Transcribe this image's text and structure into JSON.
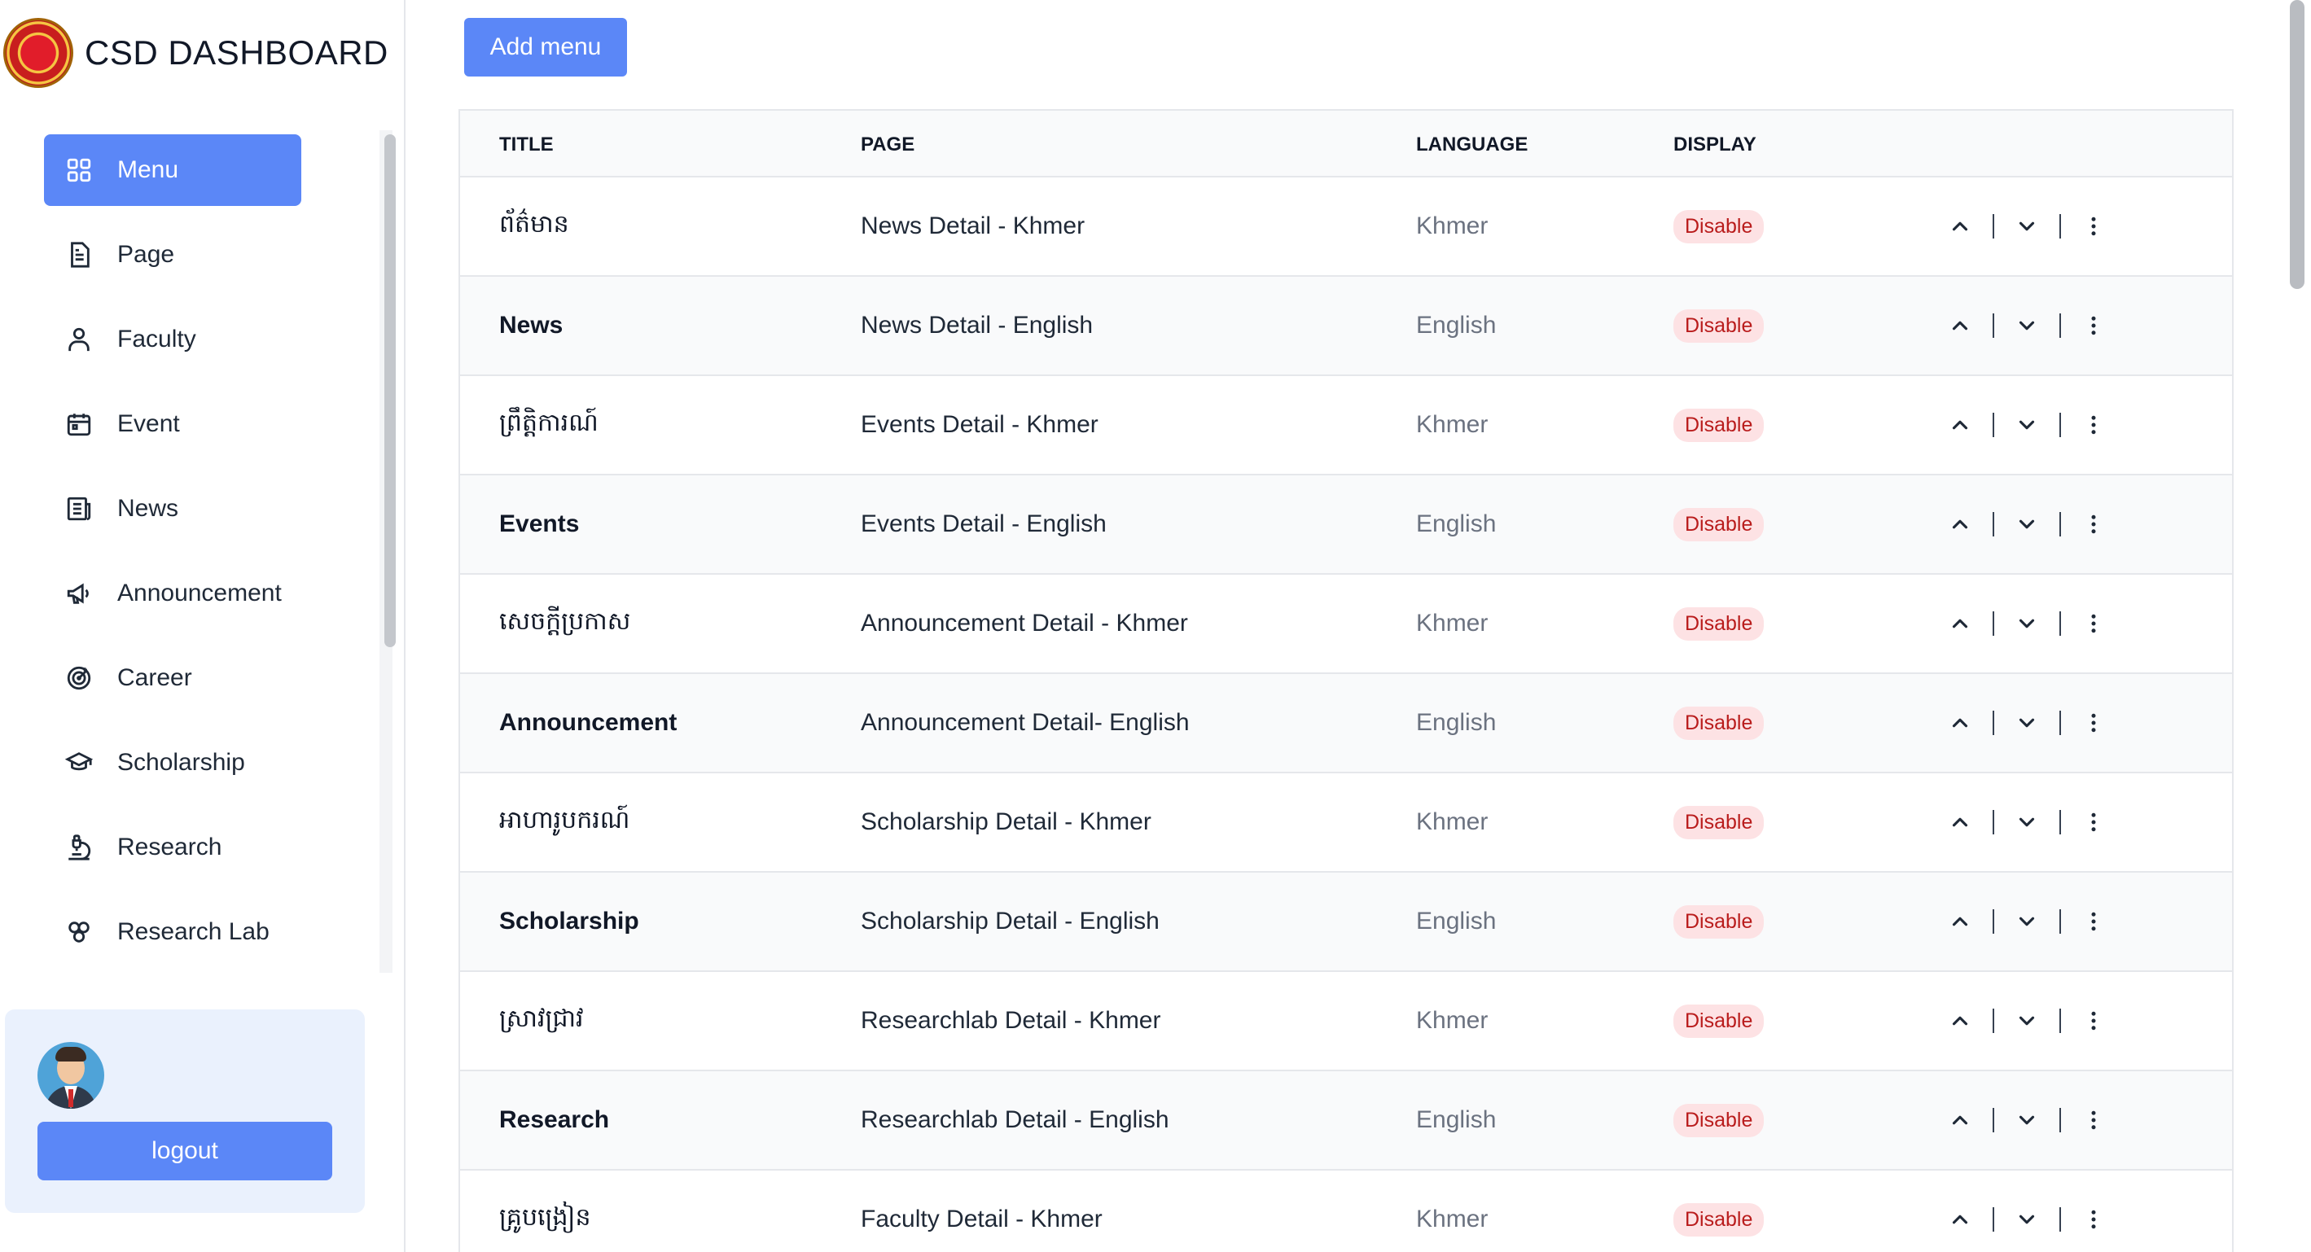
{
  "app": {
    "title": "CSD DASHBOARD"
  },
  "sidebar": {
    "items": [
      {
        "label": "Menu",
        "icon": "grid-icon",
        "active": true
      },
      {
        "label": "Page",
        "icon": "document-icon"
      },
      {
        "label": "Faculty",
        "icon": "user-icon"
      },
      {
        "label": "Event",
        "icon": "calendar-icon"
      },
      {
        "label": "News",
        "icon": "newspaper-icon"
      },
      {
        "label": "Announcement",
        "icon": "megaphone-icon"
      },
      {
        "label": "Career",
        "icon": "target-icon"
      },
      {
        "label": "Scholarship",
        "icon": "graduation-cap-icon"
      },
      {
        "label": "Research",
        "icon": "microscope-icon"
      },
      {
        "label": "Research Lab",
        "icon": "molecule-icon"
      }
    ]
  },
  "user": {
    "logout_label": "logout"
  },
  "toolbar": {
    "add_label": "Add menu"
  },
  "table": {
    "headers": {
      "title": "TITLE",
      "page": "PAGE",
      "language": "LANGUAGE",
      "display": "DISPLAY"
    },
    "rows": [
      {
        "title": "ព័ត៌មាន",
        "page": "News Detail - Khmer",
        "language": "Khmer",
        "display": "Disable"
      },
      {
        "title": "News",
        "page": "News Detail - English",
        "language": "English",
        "display": "Disable"
      },
      {
        "title": "ព្រឹត្តិការណ៍",
        "page": "Events Detail - Khmer",
        "language": "Khmer",
        "display": "Disable"
      },
      {
        "title": "Events",
        "page": "Events Detail - English",
        "language": "English",
        "display": "Disable"
      },
      {
        "title": "សេចក្តីប្រកាស",
        "page": "Announcement Detail - Khmer",
        "language": "Khmer",
        "display": "Disable"
      },
      {
        "title": "Announcement",
        "page": "Announcement Detail- English",
        "language": "English",
        "display": "Disable"
      },
      {
        "title": "អាហារូបករណ៍",
        "page": "Scholarship Detail - Khmer",
        "language": "Khmer",
        "display": "Disable"
      },
      {
        "title": "Scholarship",
        "page": "Scholarship Detail - English",
        "language": "English",
        "display": "Disable"
      },
      {
        "title": "ស្រាវជ្រាវ",
        "page": "Researchlab Detail - Khmer",
        "language": "Khmer",
        "display": "Disable"
      },
      {
        "title": "Research",
        "page": "Researchlab Detail - English",
        "language": "English",
        "display": "Disable"
      },
      {
        "title": "គ្រូបង្រៀន",
        "page": "Faculty Detail - Khmer",
        "language": "Khmer",
        "display": "Disable"
      }
    ]
  },
  "colors": {
    "accent": "#5b87f7",
    "badge_bg": "#fde2e4",
    "badge_text": "#b91c1c"
  }
}
